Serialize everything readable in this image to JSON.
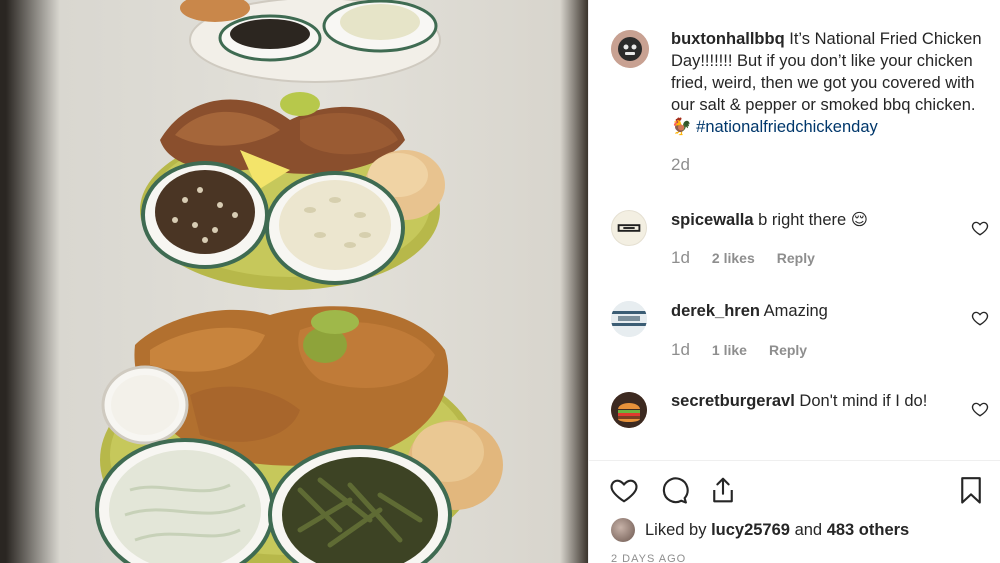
{
  "post": {
    "author": "buxtonhallbbq",
    "caption": "It’s National Fried Chicken Day!!!!!!! But if you don’t like your chicken fried, weird, then we got you covered with our salt & pepper or smoked bbq chicken.🐓",
    "hashtag": "#nationalfriedchickenday",
    "time_ago": "2d"
  },
  "comments": [
    {
      "user": "spicewalla",
      "text": "b right there 😌",
      "time": "1d",
      "likes": "2 likes",
      "reply": "Reply"
    },
    {
      "user": "derek_hren",
      "text": "Amazing",
      "time": "1d",
      "likes": "1 like",
      "reply": "Reply"
    },
    {
      "user": "secretburgeravl",
      "text": "Don't mind if I do!"
    }
  ],
  "likes": {
    "prefix": "Liked by",
    "user": "lucy25769",
    "middle": "and",
    "others": "483 others"
  },
  "date_label": "2 DAYS AGO",
  "icons": {
    "like": "heart-icon",
    "comment": "comment-icon",
    "share": "share-icon",
    "save": "bookmark-icon",
    "comment_like": "heart-outline-icon"
  },
  "colors": {
    "text": "#262626",
    "muted": "#8e8e8e",
    "hashtag": "#00376b",
    "divider": "#efefef"
  }
}
